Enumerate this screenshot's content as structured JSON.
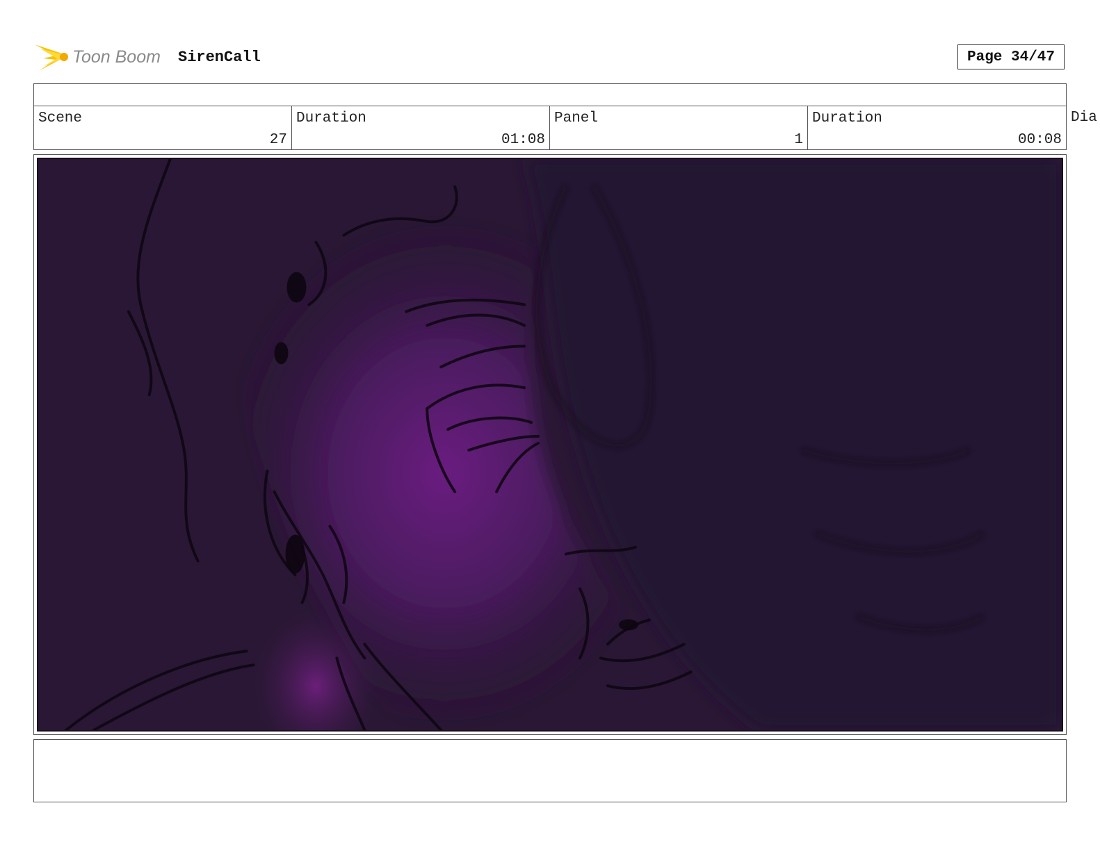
{
  "header": {
    "logo_text": "Toon Boom",
    "project_title": "SirenCall",
    "page_label": "Page 34/47"
  },
  "info": {
    "scene": {
      "label": "Scene",
      "value": "27"
    },
    "scene_duration": {
      "label": "Duration",
      "value": "01:08"
    },
    "panel": {
      "label": "Panel",
      "value": "1"
    },
    "panel_duration": {
      "label": "Duration",
      "value": "00:08"
    },
    "overflow_label": "Dia"
  },
  "colors": {
    "logo_star": "#f6c400",
    "logo_text": "#8a8a8a",
    "panel_dark": "#1f1229",
    "panel_purple": "#5a1f6a"
  },
  "icons": {
    "logo": "toon-boom-star-icon"
  }
}
